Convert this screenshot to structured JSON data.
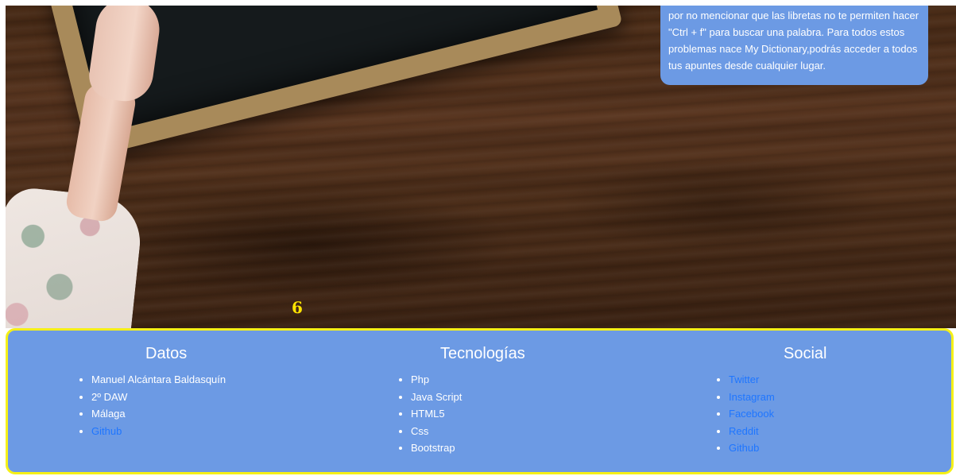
{
  "hero": {
    "info_text": "por no mencionar que las libretas no te permiten hacer \"Ctrl + f\" para buscar una palabra. Para todos estos problemas nace My Dictionary,podrás acceder a todos tus apuntes desde cualquier lugar.",
    "page_number": "6"
  },
  "footer": {
    "border_color": "#f5f018",
    "background_color": "#6c9ae4",
    "link_color": "#1f76ff",
    "datos": {
      "title": "Datos",
      "items": [
        "Manuel Alcántara Baldasquín",
        "2º DAW",
        "Málaga"
      ],
      "link": "Github"
    },
    "tecnologias": {
      "title": "Tecnologías",
      "items": [
        "Php",
        "Java Script",
        "HTML5",
        "Css",
        "Bootstrap"
      ]
    },
    "social": {
      "title": "Social",
      "links": [
        "Twitter",
        "Instagram",
        "Facebook",
        "Reddit",
        "Github"
      ]
    }
  }
}
